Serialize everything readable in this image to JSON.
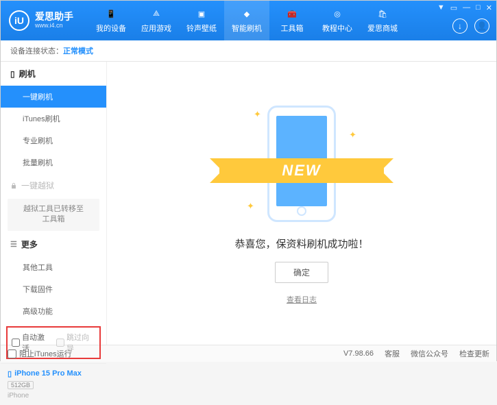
{
  "logo": {
    "badge": "iU",
    "title": "爱思助手",
    "url": "www.i4.cn"
  },
  "nav": [
    {
      "label": "我的设备"
    },
    {
      "label": "应用游戏"
    },
    {
      "label": "铃声壁纸"
    },
    {
      "label": "智能刷机"
    },
    {
      "label": "工具箱"
    },
    {
      "label": "教程中心"
    },
    {
      "label": "爱思商城"
    }
  ],
  "win": {
    "menu": "▼",
    "compact": "▭",
    "min": "—",
    "max": "□",
    "close": "✕"
  },
  "headerIcons": {
    "download": "↓",
    "user": "👤"
  },
  "status": {
    "label": "设备连接状态：",
    "value": "正常模式"
  },
  "sidebar": {
    "flash": {
      "header": "刷机",
      "items": [
        "一键刷机",
        "iTunes刷机",
        "专业刷机",
        "批量刷机"
      ]
    },
    "jailbreak": {
      "header": "一键越狱",
      "moved": "越狱工具已转移至\n工具箱"
    },
    "more": {
      "header": "更多",
      "items": [
        "其他工具",
        "下载固件",
        "高级功能"
      ]
    },
    "checks": {
      "autoActivate": "自动激活",
      "skipSetup": "跳过向导"
    }
  },
  "device": {
    "name": "iPhone 15 Pro Max",
    "storage": "512GB",
    "type": "iPhone"
  },
  "content": {
    "ribbon": "NEW",
    "message": "恭喜您，保资料刷机成功啦！",
    "okBtn": "确定",
    "logLink": "查看日志"
  },
  "footer": {
    "blockItunes": "阻止iTunes运行",
    "version": "V7.98.66",
    "service": "客服",
    "wechat": "微信公众号",
    "update": "检查更新"
  }
}
